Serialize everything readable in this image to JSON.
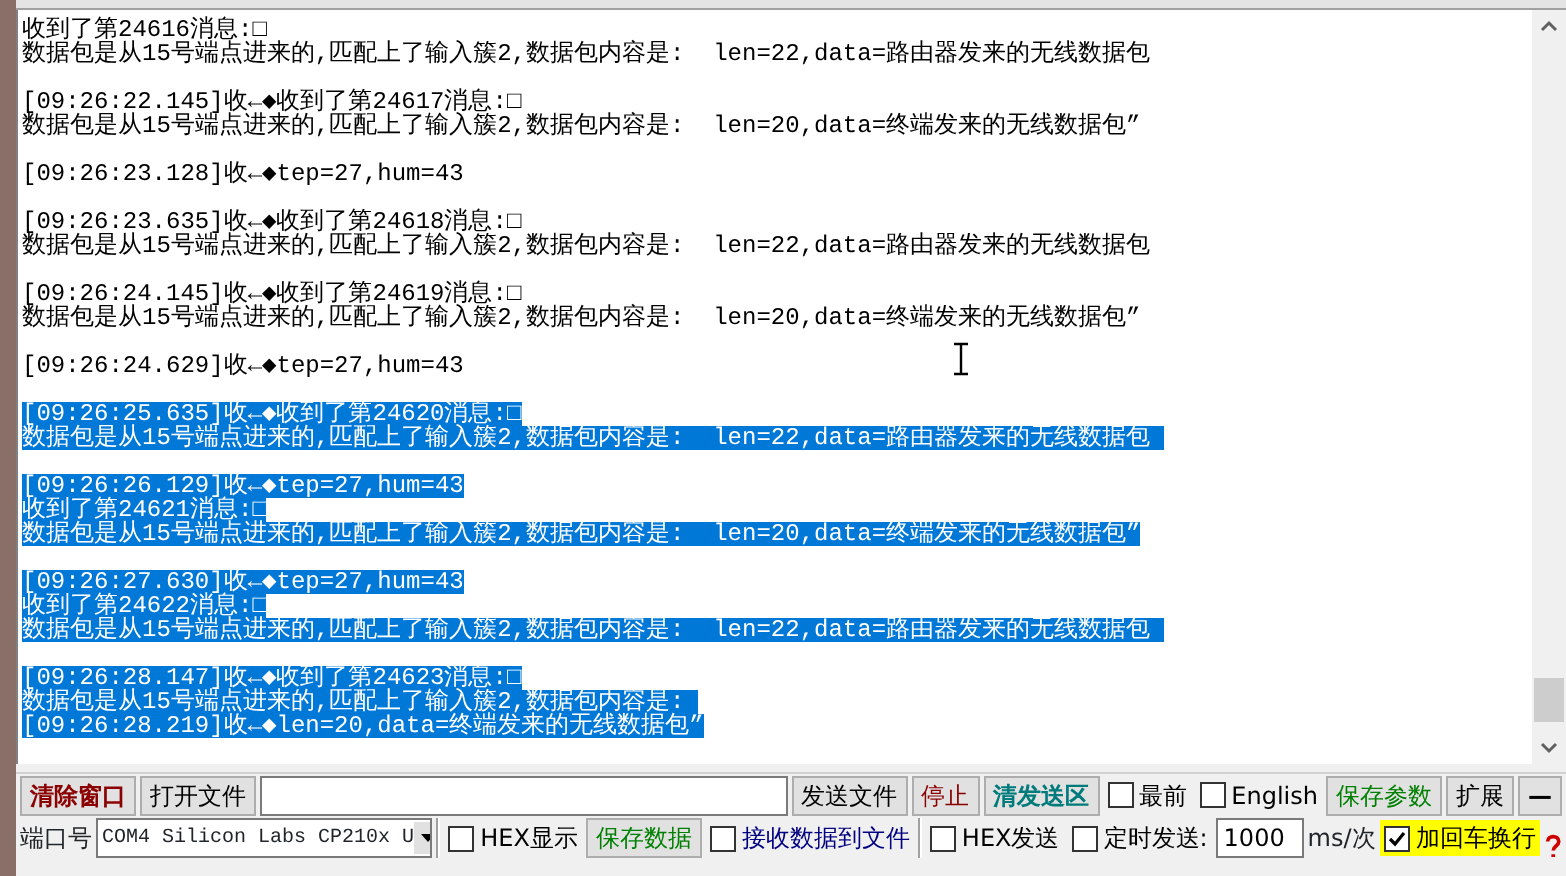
{
  "log": {
    "blocks": [
      {
        "selected": false,
        "lines": [
          "收到了第24616消息:□",
          "数据包是从15号端点进来的,匹配上了输入簇2,数据包内容是:  len=22,data=路由器发来的无线数据包"
        ]
      },
      {
        "selected": false,
        "lines": [
          "[09:26:22.145]收←◆收到了第24617消息:□",
          "数据包是从15号端点进来的,匹配上了输入簇2,数据包内容是:  len=20,data=终端发来的无线数据包”"
        ]
      },
      {
        "selected": false,
        "lines": [
          "[09:26:23.128]收←◆tep=27,hum=43"
        ]
      },
      {
        "selected": false,
        "lines": [
          "[09:26:23.635]收←◆收到了第24618消息:□",
          "数据包是从15号端点进来的,匹配上了输入簇2,数据包内容是:  len=22,data=路由器发来的无线数据包"
        ]
      },
      {
        "selected": false,
        "lines": [
          "[09:26:24.145]收←◆收到了第24619消息:□",
          "数据包是从15号端点进来的,匹配上了输入簇2,数据包内容是:  len=20,data=终端发来的无线数据包”"
        ]
      },
      {
        "selected": false,
        "lines": [
          "[09:26:24.629]收←◆tep=27,hum=43"
        ]
      },
      {
        "selected": true,
        "lines": [
          "[09:26:25.635]收←◆收到了第24620消息:□",
          "数据包是从15号端点进来的,匹配上了输入簇2,数据包内容是:  len=22,data=路由器发来的无线数据包 "
        ]
      },
      {
        "selected": true,
        "lines": [
          "[09:26:26.129]收←◆tep=27,hum=43",
          "收到了第24621消息:□",
          "数据包是从15号端点进来的,匹配上了输入簇2,数据包内容是:  len=20,data=终端发来的无线数据包”"
        ]
      },
      {
        "selected": true,
        "lines": [
          "[09:26:27.630]收←◆tep=27,hum=43",
          "收到了第24622消息:□",
          "数据包是从15号端点进来的,匹配上了输入簇2,数据包内容是:  len=22,data=路由器发来的无线数据包 "
        ]
      },
      {
        "selected": true,
        "lines": [
          "[09:26:28.147]收←◆收到了第24623消息:□",
          "数据包是从15号端点进来的,匹配上了输入簇2,数据包内容是: ",
          "[09:26:28.219]收←◆len=20,data=终端发来的无线数据包”"
        ]
      }
    ]
  },
  "toolbar_row_1": [
    {
      "kind": "button",
      "label": "清除窗口",
      "color": "#8b0000",
      "bold": true
    },
    {
      "kind": "button",
      "label": "打开文件",
      "color": "#000000",
      "bold": false
    },
    {
      "kind": "field"
    },
    {
      "kind": "button",
      "label": "发送文件",
      "color": "#000000",
      "bold": false
    },
    {
      "kind": "button",
      "label": "停止",
      "color": "#8b0000",
      "bold": false
    },
    {
      "kind": "button",
      "label": "清发送区",
      "color": "#007b7b",
      "bold": true
    },
    {
      "kind": "checkbox",
      "label": "最前",
      "checked": false,
      "highlighted": false,
      "color": "#000000"
    },
    {
      "kind": "checkbox",
      "label": "English",
      "checked": false,
      "highlighted": false,
      "color": "#000000"
    },
    {
      "kind": "button",
      "label": "保存参数",
      "color": "#008000",
      "bold": false
    },
    {
      "kind": "button",
      "label": "扩展",
      "color": "#000000",
      "bold": false
    },
    {
      "kind": "button",
      "label": "—",
      "color": "#000000",
      "bold": true
    }
  ],
  "toolbar_row_2": [
    {
      "kind": "label",
      "label": "端口号"
    },
    {
      "kind": "select",
      "value": "COM4 Silicon Labs CP210x U"
    },
    {
      "kind": "separator"
    },
    {
      "kind": "checkbox",
      "label": "HEX显示",
      "checked": false,
      "highlighted": false,
      "color": "#000000"
    },
    {
      "kind": "button",
      "label": "保存数据",
      "color": "#008000",
      "bold": false
    },
    {
      "kind": "checkbox",
      "label": "接收数据到文件",
      "checked": false,
      "highlighted": false,
      "color": "#000080"
    },
    {
      "kind": "separator"
    },
    {
      "kind": "checkbox",
      "label": "HEX发送",
      "checked": false,
      "highlighted": false,
      "color": "#000000"
    },
    {
      "kind": "checkbox",
      "label": "定时发送:",
      "checked": false,
      "highlighted": false,
      "color": "#000000"
    },
    {
      "kind": "field",
      "value": "1000"
    },
    {
      "kind": "label",
      "label": "ms/次"
    },
    {
      "kind": "checkbox",
      "label": "加回车换行",
      "checked": true,
      "highlighted": true
    },
    {
      "kind": "help"
    }
  ]
}
